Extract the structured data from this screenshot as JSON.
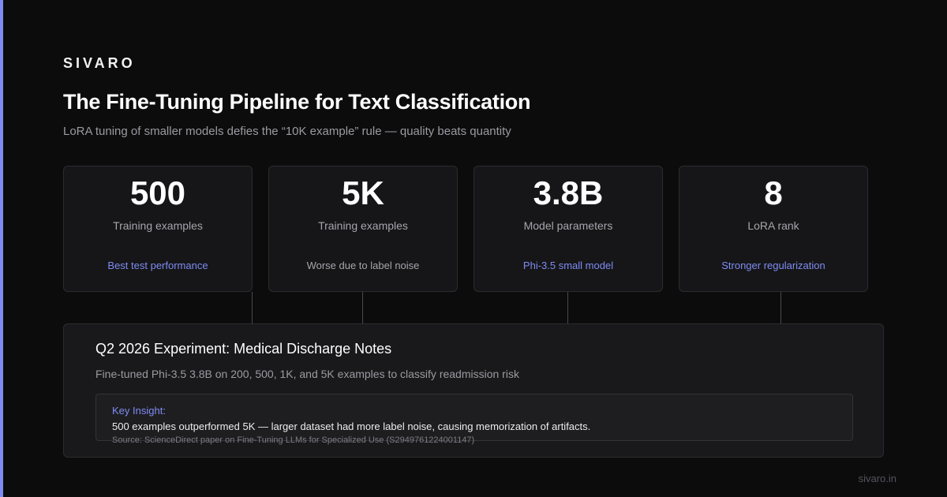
{
  "brand": "SIVARO",
  "title": "The Fine-Tuning Pipeline for Text Classification",
  "subtitle": "LoRA tuning of smaller models defies the “10K example” rule — quality beats quantity",
  "colors": {
    "background": "#0c0c0d",
    "accent": "#7f8cf2",
    "highlight_note": "#7f8cf2",
    "muted_note": "#a5a5ad"
  },
  "stats": [
    {
      "value": "500",
      "label": "Training examples",
      "note": "Best test performance",
      "note_color": "#7f8cf2"
    },
    {
      "value": "5K",
      "label": "Training examples",
      "note": "Worse due to label noise",
      "note_color": "#a5a5ad"
    },
    {
      "value": "3.8B",
      "label": "Model parameters",
      "note": "Phi-3.5 small model",
      "note_color": "#7f8cf2"
    },
    {
      "value": "8",
      "label": "LoRA rank",
      "note": "Stronger regularization",
      "note_color": "#7f8cf2"
    }
  ],
  "experiment": {
    "title": "Q2 2026 Experiment: Medical Discharge Notes",
    "description": "Fine-tuned Phi-3.5 3.8B on 200, 500, 1K, and 5K examples to classify readmission risk",
    "insight": {
      "heading": "Key Insight:",
      "text": "500 examples outperformed 5K — larger dataset had more label noise, causing memorization of artifacts.",
      "source": "Source: ScienceDirect paper on Fine-Tuning LLMs for Specialized Use (S2949761224001147)"
    }
  },
  "footer": {
    "url": "sivaro.in"
  }
}
